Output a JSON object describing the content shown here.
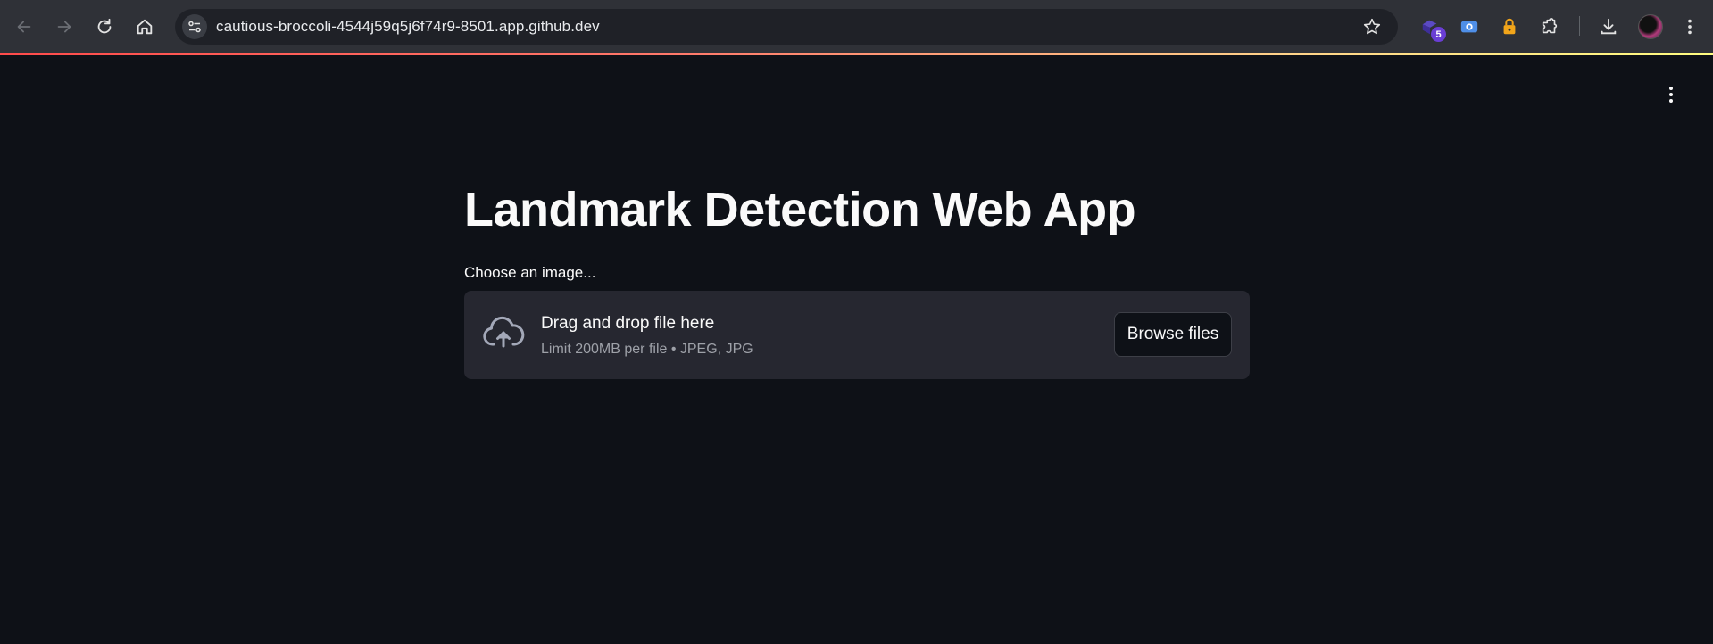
{
  "browser": {
    "url": "cautious-broccoli-4544j59q5j6f74r9-8501.app.github.dev",
    "extension_badge": "5",
    "accent_gradient": [
      "#ff4b4b",
      "#ffd38a",
      "#fffd80"
    ]
  },
  "icons": {
    "back": "arrow-left-icon",
    "forward": "arrow-right-icon",
    "reload": "reload-icon",
    "home": "home-icon",
    "site_info": "tune-icon",
    "bookmark": "star-icon",
    "extensions": "puzzle-icon",
    "downloads": "download-icon",
    "menu": "vertical-dots-icon",
    "upload": "cloud-upload-icon"
  },
  "app": {
    "title": "Landmark Detection Web App",
    "uploader": {
      "label": "Choose an image...",
      "drop_title": "Drag and drop file here",
      "drop_limit": "Limit 200MB per file • JPEG, JPG",
      "browse_label": "Browse files"
    }
  },
  "colors": {
    "background": "#0e1117",
    "dropzone": "#262730",
    "text": "#fafafa",
    "muted_text": "#9ea1a8"
  }
}
